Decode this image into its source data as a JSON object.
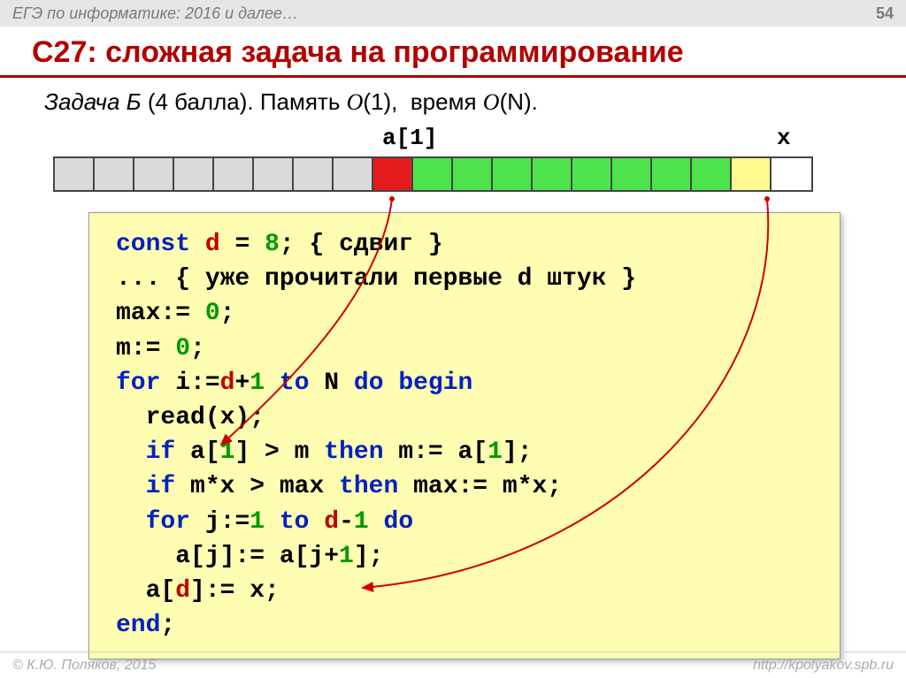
{
  "header": {
    "breadcrumb": "ЕГЭ по информатике: 2016 и далее…",
    "page": "54"
  },
  "title": "C27: сложная задача на программирование",
  "subtitle": {
    "task": "Задача Б",
    "score": "(4 балла).",
    "mem_label": "Память",
    "mem_big_o": "O",
    "mem_arg": "(1),",
    "time_label": "время",
    "time_big_o": "O",
    "time_arg": "(N)."
  },
  "strip": {
    "label_a1": "a[1]",
    "label_x": "x",
    "cells": [
      "grey",
      "grey",
      "grey",
      "grey",
      "grey",
      "grey",
      "grey",
      "grey",
      "red",
      "green",
      "green",
      "green",
      "green",
      "green",
      "green",
      "green",
      "green",
      "yellow",
      "white"
    ]
  },
  "code": {
    "l1": {
      "kw1": "const",
      "var": "d",
      "eq": " = ",
      "n": "8",
      "rest": "; { сдвиг }"
    },
    "l2": "... { уже прочитали первые d штук }",
    "l3": {
      "t": "max:= ",
      "n": "0",
      "s": ";"
    },
    "l4": {
      "t": "m:= ",
      "n": "0",
      "s": ";"
    },
    "l5": {
      "kw1": "for",
      "sp1": " i:=",
      "var": "d",
      "plus": "+",
      "one": "1",
      "sp2": " ",
      "kw2": "to",
      "sp3": " N ",
      "kw3": "do begin"
    },
    "l6": "  read(x);",
    "l7": {
      "pre": "  ",
      "kw": "if",
      "mid1": " a[",
      "n1": "1",
      "mid2": "] > m ",
      "kw2": "then",
      "mid3": " m:= a[",
      "n2": "1",
      "end": "];"
    },
    "l8": {
      "pre": "  ",
      "kw": "if",
      "mid": " m*x > max ",
      "kw2": "then",
      "end": " max:= m*x;"
    },
    "l9": {
      "pre": "  ",
      "kw": "for",
      "mid1": " j:=",
      "n1": "1",
      "sp": " ",
      "kw2": "to",
      "mid2": " ",
      "var": "d",
      "minus": "-",
      "n2": "1",
      "sp2": " ",
      "kw3": "do"
    },
    "l10": {
      "pre": "    a[j]:= a[j+",
      "n": "1",
      "end": "];"
    },
    "l11": {
      "pre": "  a[",
      "var": "d",
      "end": "]:= x;"
    },
    "l12": {
      "kw": "end",
      "s": ";"
    }
  },
  "footer": {
    "copyright": "© К.Ю. Поляков, 2015",
    "url": "http://kpolyakov.spb.ru"
  }
}
